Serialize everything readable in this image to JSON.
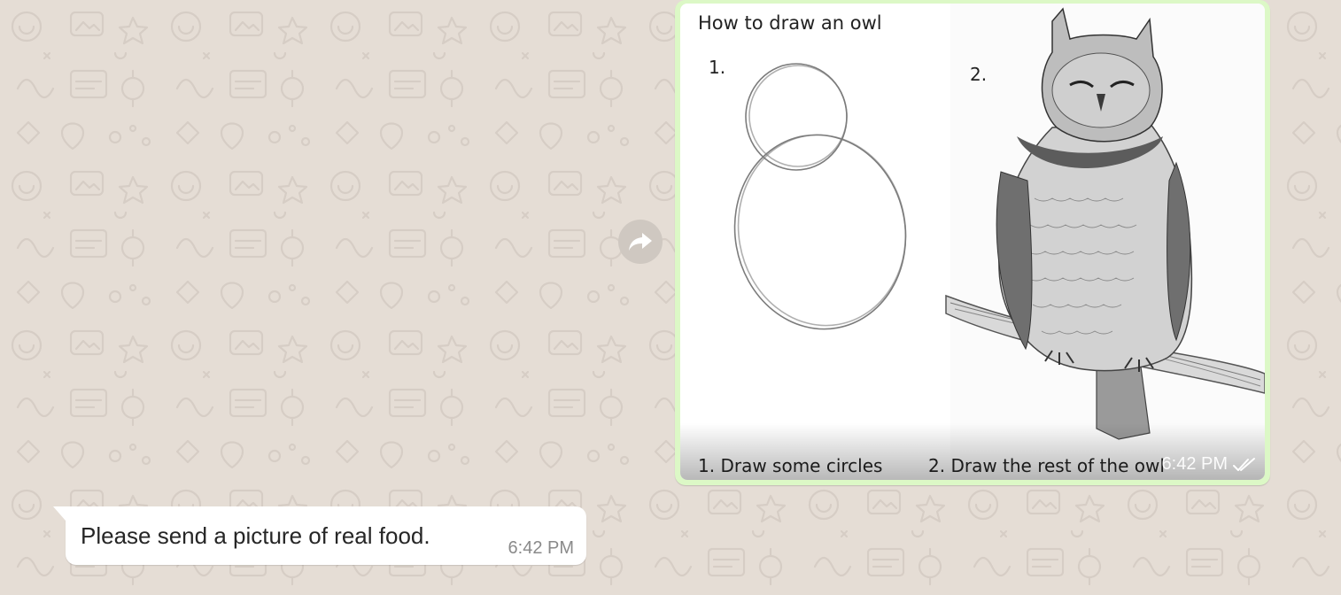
{
  "chat": {
    "wallpaper_color": "#e5ddd5",
    "messages": [
      {
        "type": "image",
        "direction": "outgoing",
        "image": {
          "title": "How to draw an owl",
          "step1_number": "1.",
          "step2_number": "2.",
          "caption1": "1. Draw some circles",
          "caption2": "2. Draw the rest of the owl"
        },
        "time": "6:42 PM",
        "status_icon": "double-check-icon",
        "bubble_color": "#dcf8c6"
      },
      {
        "type": "text",
        "direction": "incoming",
        "text": "Please send a picture of real food.",
        "time": "6:42 PM",
        "bubble_color": "#ffffff"
      }
    ]
  },
  "forward_button": {
    "icon": "forward-icon"
  }
}
